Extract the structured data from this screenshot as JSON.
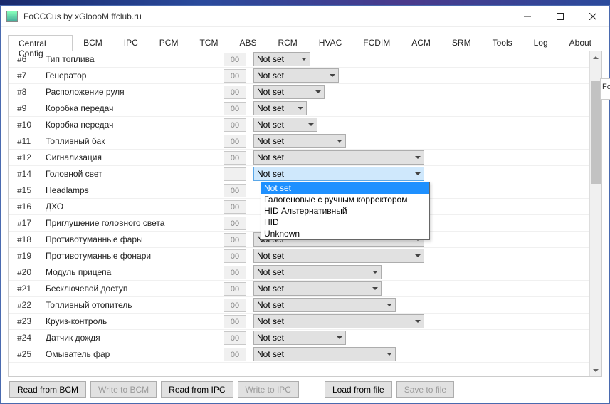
{
  "window": {
    "title": "FoCCCus by xGlоооM ffclub.ru"
  },
  "tabs": [
    "Central Config",
    "BCM",
    "IPC",
    "PCM",
    "TCM",
    "ABS",
    "RCM",
    "HVAC",
    "FCDIM",
    "ACM",
    "SRM",
    "Tools",
    "Log",
    "About"
  ],
  "active_tab": 0,
  "rows": [
    {
      "id": "#6",
      "name": "Тип топлива",
      "code": "00",
      "value": "Not set",
      "combo_w": 80
    },
    {
      "id": "#7",
      "name": "Генератор",
      "code": "00",
      "value": "Not set",
      "combo_w": 120
    },
    {
      "id": "#8",
      "name": "Расположение руля",
      "code": "00",
      "value": "Not set",
      "combo_w": 100
    },
    {
      "id": "#9",
      "name": "Коробка передач",
      "code": "00",
      "value": "Not set",
      "combo_w": 75
    },
    {
      "id": "#10",
      "name": "Коробка передач",
      "code": "00",
      "value": "Not set",
      "combo_w": 90
    },
    {
      "id": "#11",
      "name": "Топливный бак",
      "code": "00",
      "value": "Not set",
      "combo_w": 130
    },
    {
      "id": "#12",
      "name": "Сигнализация",
      "code": "00",
      "value": "Not set",
      "combo_w": 240
    },
    {
      "id": "#14",
      "name": "Головной свет",
      "code": "",
      "value": "Not set",
      "combo_w": 240,
      "open": true
    },
    {
      "id": "#15",
      "name": "Headlamps",
      "code": "00",
      "value": "",
      "combo_w": 0
    },
    {
      "id": "#16",
      "name": "ДХО",
      "code": "00",
      "value": "",
      "combo_w": 0
    },
    {
      "id": "#17",
      "name": "Приглушение головного света",
      "code": "00",
      "value": "",
      "combo_w": 0,
      "tail_arrow": true
    },
    {
      "id": "#18",
      "name": "Противотуманные фары",
      "code": "00",
      "value": "Not set",
      "combo_w": 240
    },
    {
      "id": "#19",
      "name": "Противотуманные фонари",
      "code": "00",
      "value": "Not set",
      "combo_w": 240
    },
    {
      "id": "#20",
      "name": "Модуль прицепа",
      "code": "00",
      "value": "Not set",
      "combo_w": 180
    },
    {
      "id": "#21",
      "name": "Бесключевой доступ",
      "code": "00",
      "value": "Not set",
      "combo_w": 180
    },
    {
      "id": "#22",
      "name": "Топливный отопитель",
      "code": "00",
      "value": "Not set",
      "combo_w": 200
    },
    {
      "id": "#23",
      "name": "Круиз-контроль",
      "code": "00",
      "value": "Not set",
      "combo_w": 240
    },
    {
      "id": "#24",
      "name": "Датчик дождя",
      "code": "00",
      "value": "Not set",
      "combo_w": 130
    },
    {
      "id": "#25",
      "name": "Омыватель фар",
      "code": "00",
      "value": "Not set",
      "combo_w": 200
    }
  ],
  "dropdown": {
    "row_index": 7,
    "options": [
      "Not set",
      "Галогеновые с ручным корректором",
      "HID Альтернативный",
      "HID",
      "Unknown"
    ],
    "highlighted": 0
  },
  "scrollbar": {
    "thumb_top_pct": 6,
    "thumb_height_pct": 34
  },
  "buttons": [
    {
      "label": "Read from BCM",
      "disabled": false
    },
    {
      "label": "Write to BCM",
      "disabled": true
    },
    {
      "label": "Read from IPC",
      "disabled": false
    },
    {
      "label": "Write to IPC",
      "disabled": true
    },
    {
      "label": "Load from file",
      "disabled": false,
      "gap": true
    },
    {
      "label": "Save to file",
      "disabled": true
    }
  ],
  "right_peek": "Fo"
}
